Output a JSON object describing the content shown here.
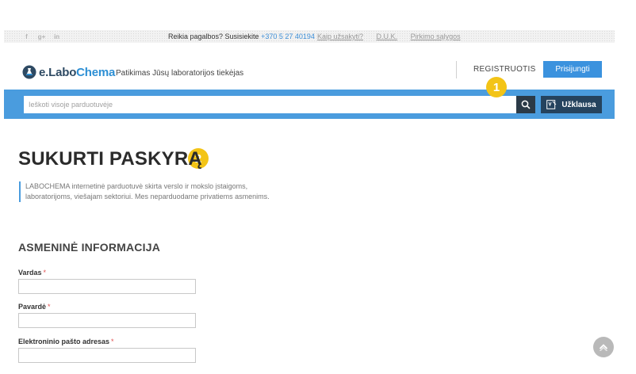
{
  "topbar": {
    "social_icons": [
      "facebook-icon",
      "google-plus-icon",
      "linkedin-icon"
    ],
    "social_glyphs": [
      "f",
      "g+",
      "in"
    ],
    "help_text": "Reikia pagalbos? Susisiekite ",
    "phone": "+370 5 27 40194",
    "links": [
      "Kaip užsakyti?",
      "D.U.K.",
      "Pirkimo sąlygos"
    ]
  },
  "header": {
    "logo": {
      "e": "e.",
      "labo": "Labo",
      "chema": "Chema"
    },
    "tagline": "Patikimas Jūsų laboratorijos tiekėjas",
    "register_label": "REGISTRUOTIS",
    "login_label": "Prisijungti"
  },
  "search": {
    "placeholder": "Ieškoti visoje parduotuvėje",
    "inquiry_label": "Užklausa"
  },
  "markers": [
    "1",
    "2"
  ],
  "page": {
    "title": "SUKURTI PASKYRĄ",
    "intro_line1": "LABOCHEMA internetinė parduotuvė skirta verslo ir mokslo įstaigoms,",
    "intro_line2": "laboratorijoms, viešajam sektoriui. Mes neparduodame privatiems asmenims.",
    "section_title": "ASMENINĖ INFORMACIJA"
  },
  "form": {
    "fields": [
      {
        "label": "Vardas",
        "required": "*",
        "value": ""
      },
      {
        "label": "Pavardė",
        "required": "*",
        "value": ""
      },
      {
        "label": "Elektroninio pašto adresas",
        "required": "*",
        "value": ""
      }
    ]
  },
  "colors": {
    "brand_blue": "#4a9cde",
    "dark_navy": "#25435e",
    "marker_yellow": "#f3c417"
  }
}
